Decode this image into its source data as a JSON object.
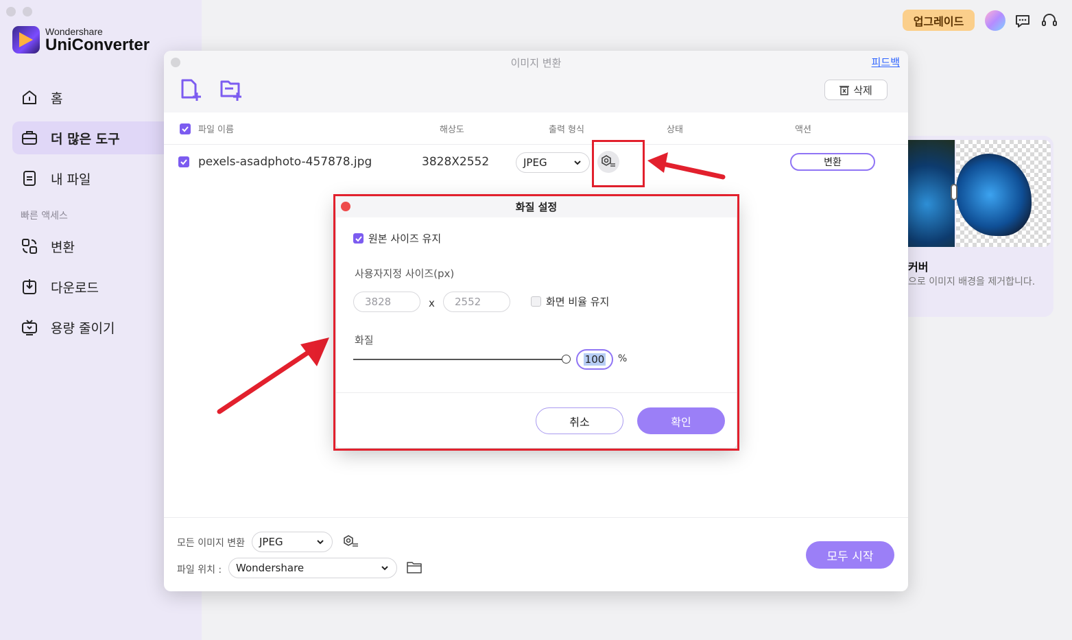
{
  "sidebar": {
    "brand_top": "Wondershare",
    "brand_name": "UniConverter",
    "items": [
      {
        "label": "홈",
        "icon": "home-icon"
      },
      {
        "label": "더 많은 도구",
        "icon": "toolbox-icon"
      },
      {
        "label": "내 파일",
        "icon": "file-icon"
      }
    ],
    "quick_access_label": "빠른 액세스",
    "quick_items": [
      {
        "label": "변환",
        "icon": "convert-icon"
      },
      {
        "label": "다운로드",
        "icon": "download-icon"
      },
      {
        "label": "용량 줄이기",
        "icon": "compress-icon"
      }
    ]
  },
  "topbar": {
    "upgrade_label": "업그레이드"
  },
  "bg_card": {
    "title": "커버",
    "desc": "으로 이미지 배경을 제거합니다."
  },
  "window": {
    "title": "이미지 변환",
    "feedback": "피드백",
    "delete_label": "삭제",
    "columns": {
      "filename": "파일 이름",
      "resolution": "해상도",
      "output_format": "출력 형식",
      "status": "상태",
      "action": "액션"
    },
    "rows": [
      {
        "filename": "pexels-asadphoto-457878.jpg",
        "resolution": "3828X2552",
        "format": "JPEG",
        "action": "변환"
      }
    ],
    "footer": {
      "convert_all_label": "모든 이미지 변환",
      "convert_all_format": "JPEG",
      "location_label": "파일 위치 :",
      "location_value": "Wondershare",
      "start_all": "모두 시작"
    }
  },
  "dialog": {
    "title": "화질 설정",
    "keep_original_label": "원본 사이즈 유지",
    "custom_size_label": "사용자지정 사이즈(px)",
    "width_value": "3828",
    "times": "x",
    "height_value": "2552",
    "keep_ratio_label": "화면 비율 유지",
    "quality_label": "화질",
    "quality_value": "100",
    "quality_unit": "%",
    "quality_level": 1.0,
    "cancel": "취소",
    "ok": "확인"
  },
  "colors": {
    "accent": "#9b7ff7",
    "annotation_red": "#e2202d",
    "upgrade_bg": "#fbcf8b"
  }
}
